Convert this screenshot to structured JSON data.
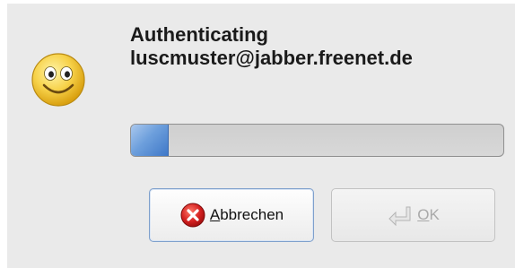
{
  "dialog": {
    "message_line1": "Authenticating",
    "message_line2": "luscmuster@jabber.freenet.de",
    "icon": "smiley-face-icon",
    "progress_fraction": 0.1
  },
  "buttons": {
    "cancel": {
      "mnemonic": "A",
      "rest": "bbrechen",
      "icon": "cancel-x-icon"
    },
    "ok": {
      "mnemonic": "O",
      "rest": "K",
      "icon": "enter-arrow-icon",
      "enabled": false
    }
  },
  "colors": {
    "progress_fill": "#5b8fd6",
    "cancel_icon": "#d42020"
  }
}
